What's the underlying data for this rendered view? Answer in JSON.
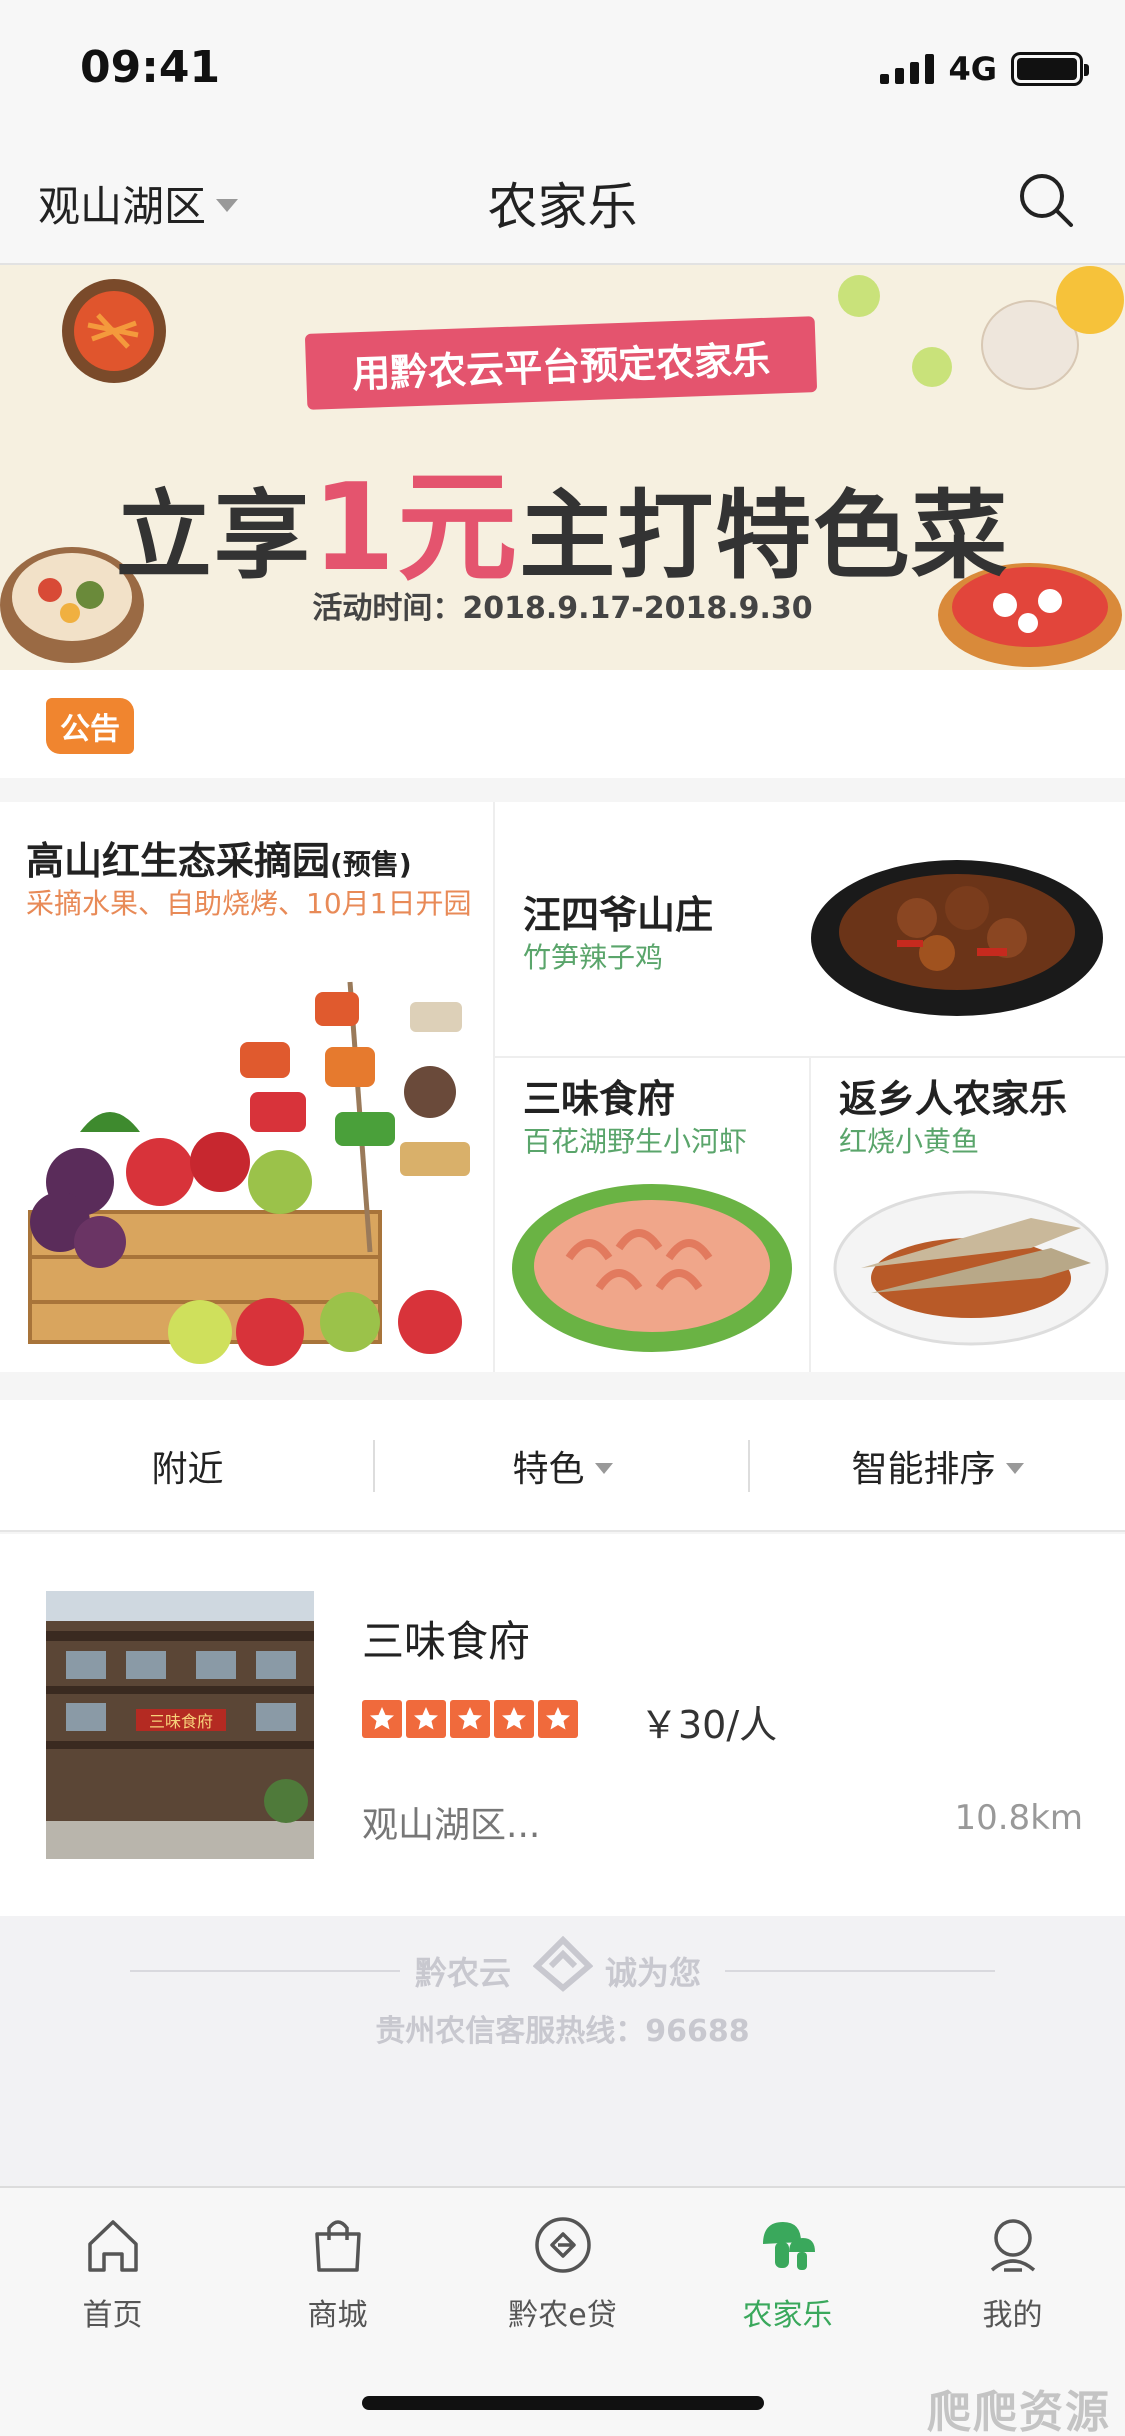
{
  "status_bar": {
    "time": "09:41",
    "network": "4G"
  },
  "nav": {
    "location": "观山湖区",
    "title": "农家乐"
  },
  "banner": {
    "ribbon": "用黔农云平台预定农家乐",
    "headline_pre": "立享",
    "headline_highlight": "1元",
    "headline_post": "主打特色菜",
    "date": "活动时间：2018.9.17-2018.9.30"
  },
  "notice": {
    "badge": "公告"
  },
  "promos": [
    {
      "title": "高山红生态采摘园",
      "tag": "(预售)",
      "subtitle": "采摘水果、自助烧烤、10月1日开园"
    },
    {
      "title": "汪四爷山庄",
      "subtitle": "竹笋辣子鸡"
    },
    {
      "title": "三味食府",
      "subtitle": "百花湖野生小河虾"
    },
    {
      "title": "返乡人农家乐",
      "subtitle": "红烧小黄鱼"
    }
  ],
  "filters": [
    {
      "label": "附近"
    },
    {
      "label": "特色"
    },
    {
      "label": "智能排序"
    }
  ],
  "listing": {
    "name": "三味食府",
    "rating": 5,
    "price": "￥30/人",
    "address": "观山湖区...",
    "distance": "10.8km",
    "sign_text": "三味食府"
  },
  "footer_brand": {
    "left": "黔农云",
    "right": "诚为您",
    "hotline": "贵州农信客服热线：96688"
  },
  "tabs": [
    {
      "label": "首页",
      "icon": "home-icon"
    },
    {
      "label": "商城",
      "icon": "shopping-bag-icon"
    },
    {
      "label": "黔农e贷",
      "icon": "loan-icon"
    },
    {
      "label": "农家乐",
      "icon": "mushroom-icon",
      "active": true
    },
    {
      "label": "我的",
      "icon": "profile-icon"
    }
  ],
  "watermark": "爬爬资源",
  "colors": {
    "accent_green": "#3aa85c",
    "star_orange": "#f06a3c",
    "notice_orange": "#f0852f",
    "ribbon_pink": "#e4546e"
  }
}
